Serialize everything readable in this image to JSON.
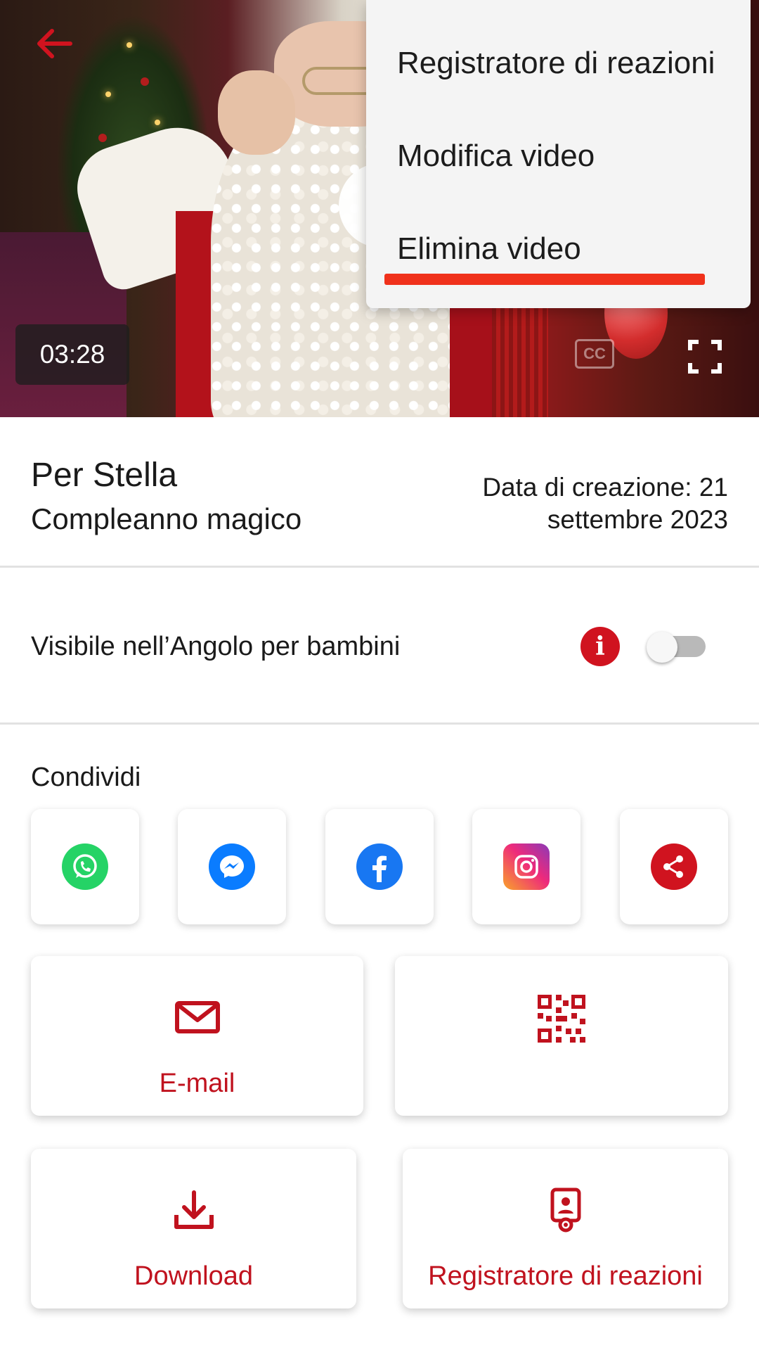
{
  "video": {
    "timestamp": "03:28",
    "cc_label": "CC"
  },
  "menu": {
    "items": [
      {
        "label": "Registratore di reazioni"
      },
      {
        "label": "Modifica video"
      },
      {
        "label": "Elimina video"
      }
    ]
  },
  "info": {
    "title": "Per Stella",
    "subtitle": "Compleanno magico",
    "created": "Data di creazione: 21 settembre 2023"
  },
  "kids_corner": {
    "label": "Visibile nell’Angolo per bambini",
    "enabled": false
  },
  "share": {
    "label": "Condividi",
    "icons": [
      "whatsapp-icon",
      "messenger-icon",
      "facebook-icon",
      "instagram-icon",
      "share-icon"
    ]
  },
  "actions": {
    "email_label": "E-mail",
    "qr_label": "",
    "download_label": "Download",
    "reaction_recorder_label": "Registratore di reazioni"
  },
  "colors": {
    "accent": "#c0121e",
    "menu_highlight": "#f0311b",
    "whatsapp": "#25d366",
    "messenger": "#0a7cff",
    "facebook": "#1877f2"
  }
}
